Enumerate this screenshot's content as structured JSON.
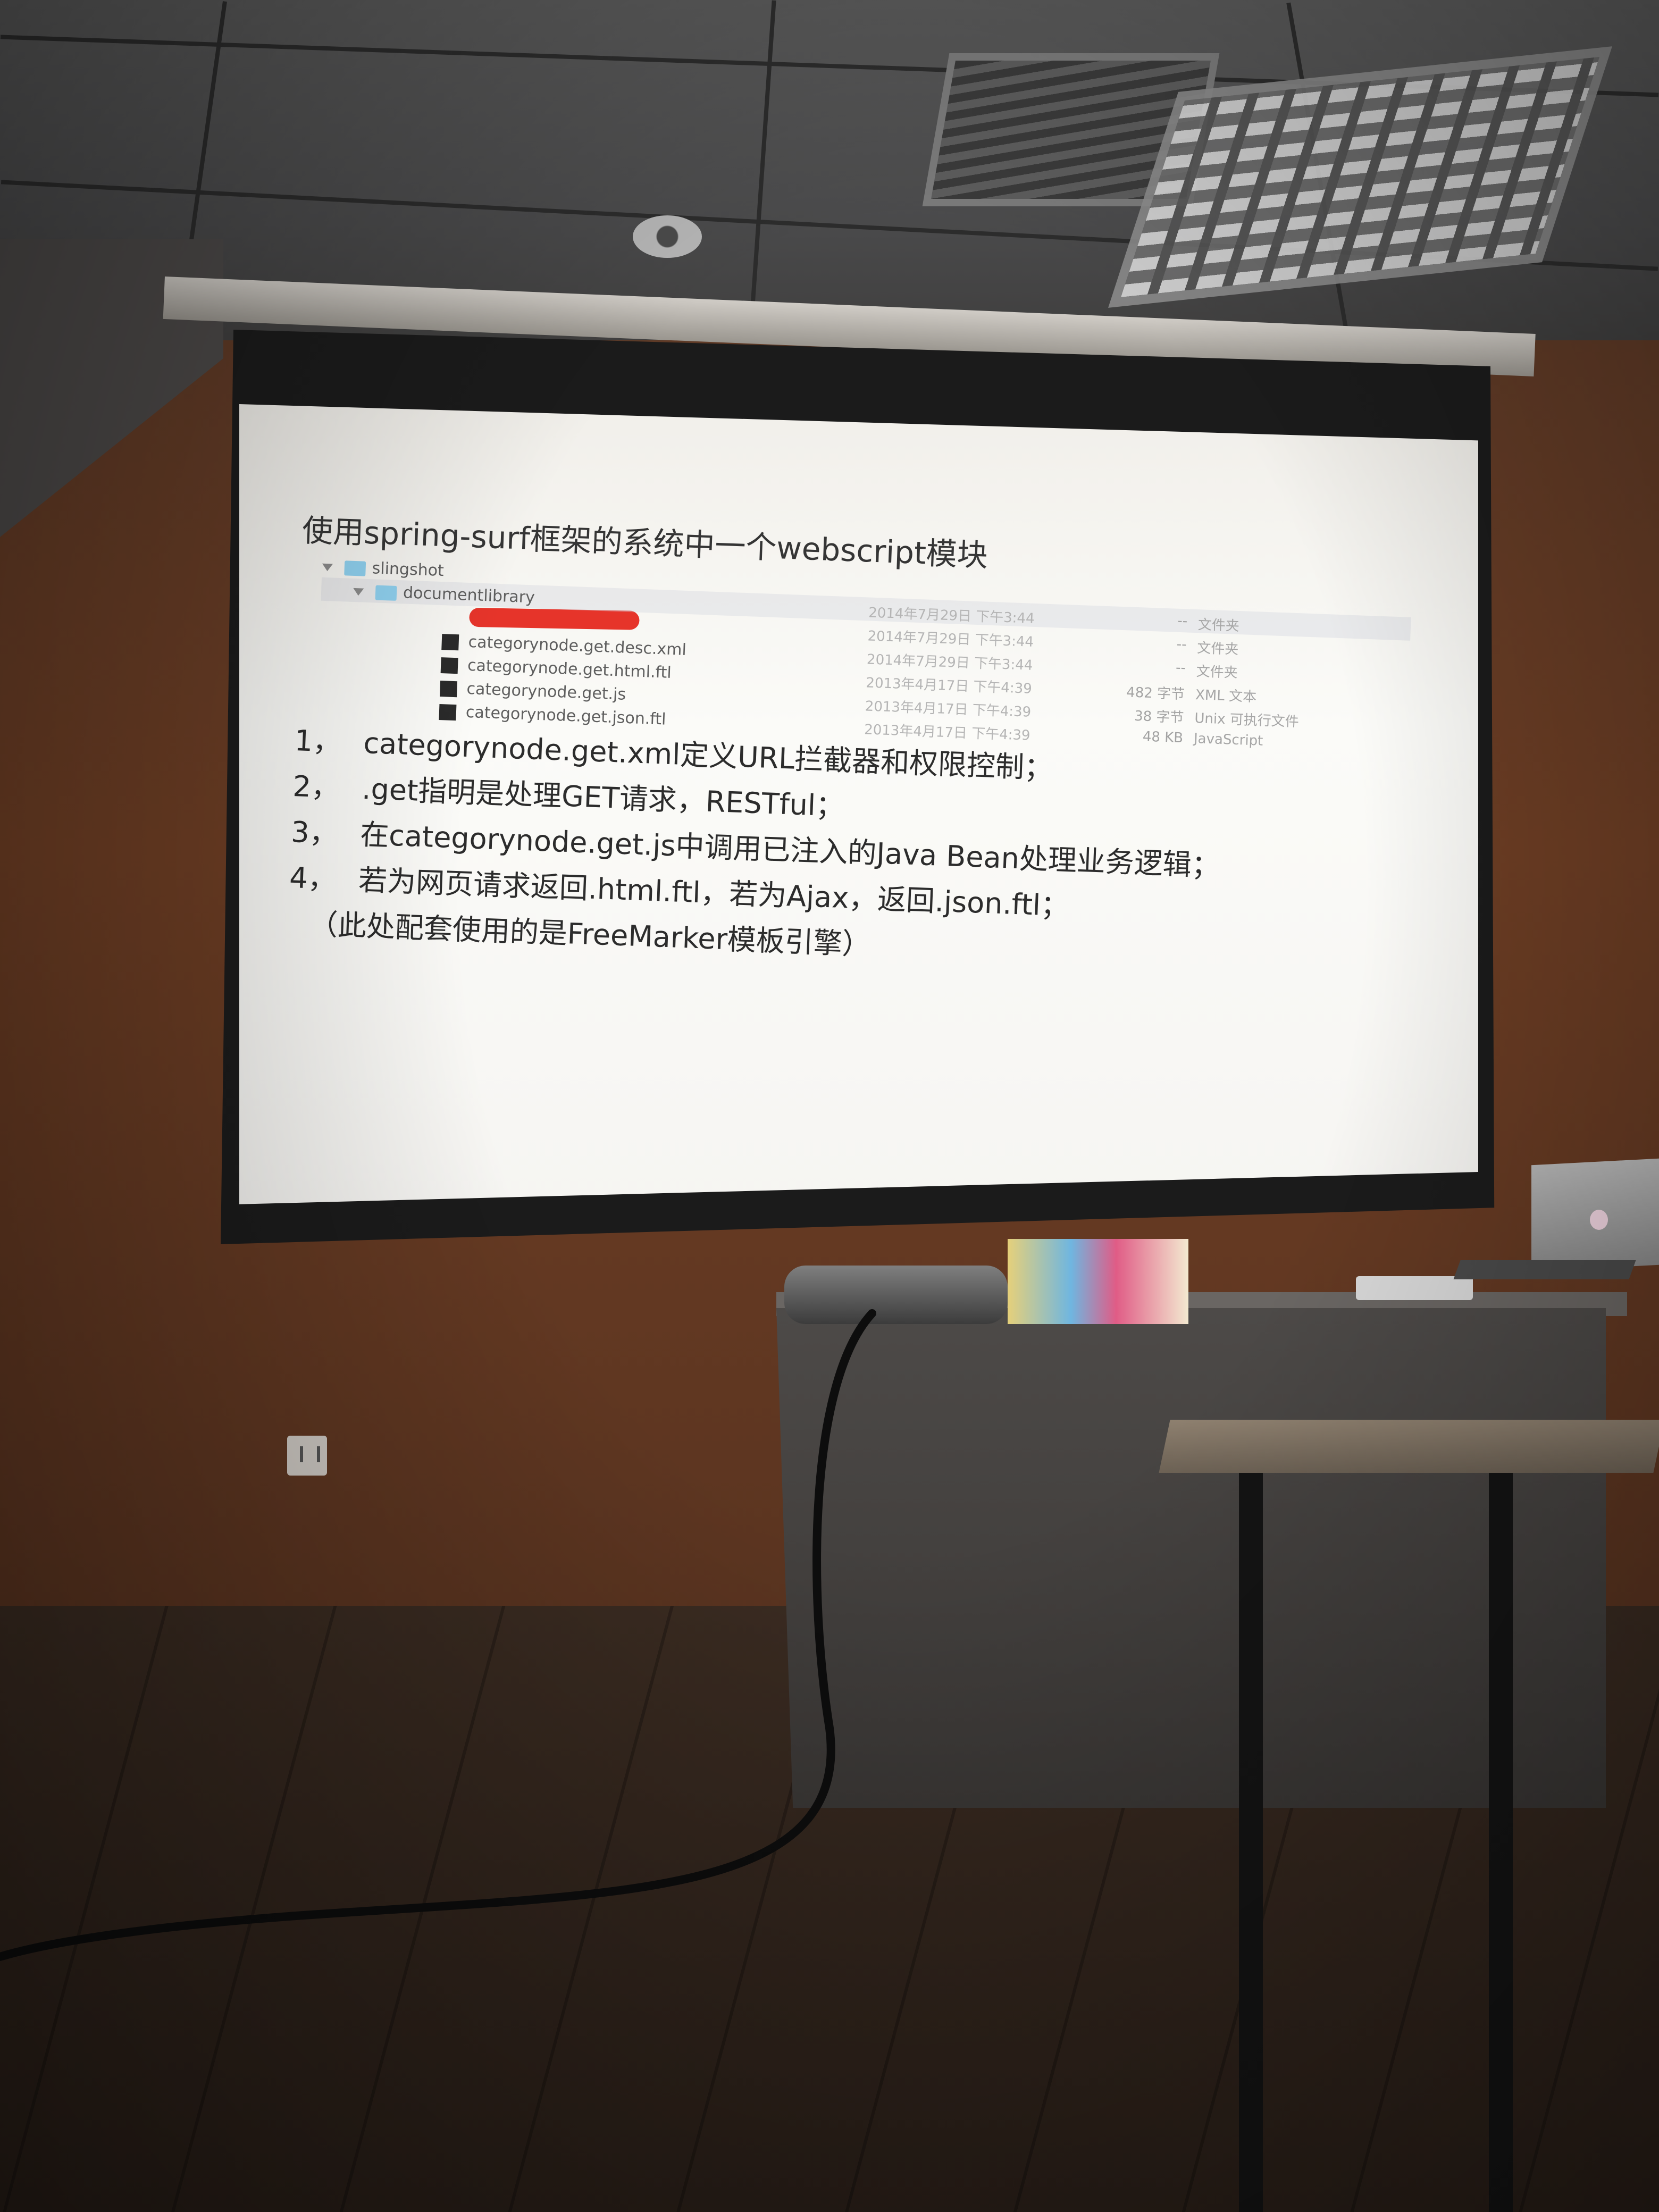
{
  "slide": {
    "title": "使用spring-surf框架的系统中一个webscript模块",
    "tree": [
      {
        "name": "slingshot",
        "type": "folder",
        "indent": 0,
        "date": "",
        "size": "",
        "kind": ""
      },
      {
        "name": "documentlibrary",
        "type": "folder",
        "indent": 1,
        "date": "2014年7月29日 下午3:44",
        "size": "--",
        "kind": "文件夹"
      },
      {
        "name": "",
        "type": "redacted",
        "indent": 1,
        "date": "2014年7月29日 下午3:44",
        "size": "--",
        "kind": "文件夹"
      },
      {
        "name": "categorynode.get.desc.xml",
        "type": "file",
        "indent": 2,
        "date": "2014年7月29日 下午3:44",
        "size": "--",
        "kind": "文件夹"
      },
      {
        "name": "categorynode.get.html.ftl",
        "type": "file",
        "indent": 2,
        "date": "2013年4月17日 下午4:39",
        "size": "482 字节",
        "kind": "XML 文本"
      },
      {
        "name": "categorynode.get.js",
        "type": "file",
        "indent": 2,
        "date": "2013年4月17日 下午4:39",
        "size": "38 字节",
        "kind": "Unix 可执行文件"
      },
      {
        "name": "categorynode.get.json.ftl",
        "type": "file",
        "indent": 2,
        "date": "2013年4月17日 下午4:39",
        "size": "48 KB",
        "kind": "JavaScript"
      }
    ],
    "points": [
      {
        "num": "1，",
        "text": "categorynode.get.xml定义URL拦截器和权限控制；"
      },
      {
        "num": "2，",
        "text": ".get指明是处理GET请求，RESTful；"
      },
      {
        "num": "3，",
        "text": "在categorynode.get.js中调用已注入的Java Bean处理业务逻辑；"
      },
      {
        "num": "4，",
        "text": "若为网页请求返回.html.ftl，若为Ajax，返回.json.ftl；"
      },
      {
        "num": "",
        "text": "（此处配套使用的是FreeMarker模板引擎）"
      }
    ]
  },
  "colors": {
    "wall": "#6e3e24",
    "screen": "#f6f5f2",
    "folder_icon": "#8fd0ee",
    "redaction": "#e6342a"
  }
}
